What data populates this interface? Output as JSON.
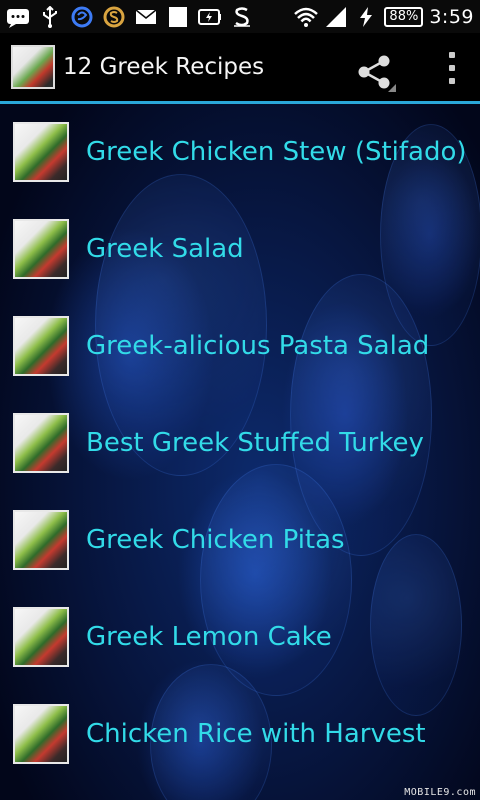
{
  "status_bar": {
    "battery": "88%",
    "time": "3:59",
    "icons": [
      "messages-icon",
      "usb-icon",
      "sync-icon",
      "app-s-icon",
      "email-icon",
      "notification-icon",
      "battery-saver-icon",
      "s-icon",
      "wifi-icon",
      "signal-icon",
      "charging-icon"
    ]
  },
  "app_bar": {
    "title": "12 Greek Recipes",
    "icons": [
      "app-logo",
      "share-icon",
      "overflow-menu-icon"
    ]
  },
  "recipes": [
    "Greek Chicken Stew (Stifado)",
    "Greek Salad",
    "Greek-alicious Pasta Salad",
    "Best Greek Stuffed Turkey",
    "Greek Chicken Pitas",
    "Greek Lemon Cake",
    "Chicken Rice with Harvest"
  ],
  "watermark": "MOBILE9.com",
  "colors": {
    "accent_line": "#2aa7d8",
    "list_text": "#32dbe8",
    "background": "#071640"
  }
}
